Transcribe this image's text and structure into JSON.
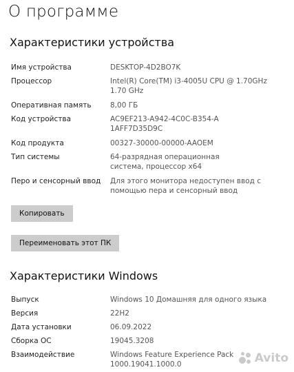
{
  "page_title": "О программе",
  "device_specs": {
    "title": "Характеристики устройства",
    "rows": [
      {
        "key": "Имя устройства",
        "value": "DESKTOP-4D2BO7K"
      },
      {
        "key": "Процессор",
        "value": "Intel(R) Core(TM) i3-4005U CPU @ 1.70GHz 1.70 GHz"
      },
      {
        "key": "Оперативная память",
        "value": "8,00 ГБ"
      },
      {
        "key": "Код устройства",
        "value": "AC9EF213-A942-4C0C-B354-A1AFF7D35D9C"
      },
      {
        "key": "Код продукта",
        "value": "00327-30000-00000-AAOEM"
      },
      {
        "key": "Тип системы",
        "value": "64-разрядная операционная система, процессор x64"
      },
      {
        "key": "Перо и сенсорный ввод",
        "value": "Для этого монитора недоступен ввод с помощью пера и сенсорный ввод"
      }
    ],
    "copy_button": "Копировать",
    "rename_button": "Переименовать этот ПК"
  },
  "windows_specs": {
    "title": "Характеристики Windows",
    "rows": [
      {
        "key": "Выпуск",
        "value": "Windows 10 Домашняя для одного языка"
      },
      {
        "key": "Версия",
        "value": "22H2"
      },
      {
        "key": "Дата установки",
        "value": "06.09.2022"
      },
      {
        "key": "Сборка ОС",
        "value": "19045.3208"
      },
      {
        "key": "Взаимодействие",
        "value": "Windows Feature Experience Pack 1000.19041.1000.0"
      }
    ]
  },
  "watermark": {
    "text": "Avito",
    "icon": "avito-logo-icon",
    "color": "#6b6b6b"
  }
}
